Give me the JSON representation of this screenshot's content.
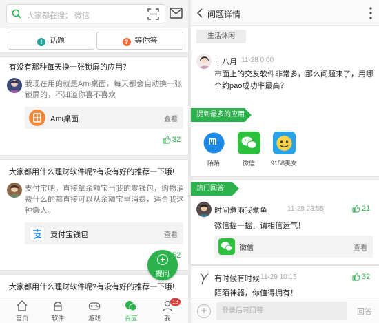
{
  "left": {
    "search": {
      "placeholder": "大家都在搜： 微信"
    },
    "segments": [
      {
        "label": "话题",
        "dot": "!",
        "color": "#26a69a"
      },
      {
        "label": "等你答",
        "dot": "?",
        "color": "#ef6c3a"
      }
    ],
    "posts": [
      {
        "question": "有没有那种每天换一张锁屏的应用？",
        "answer": "我现在用的就是Ami桌面，每天都会自动换一张锁屏的，不知道你喜不喜欢",
        "app_name": "Ami桌面",
        "app_color": "#f0893a",
        "view_label": "查看",
        "likes": "32"
      },
      {
        "question": "大家都用什么理财软件呢?有没有好的推荐一下哦!",
        "answer": "支付宝吧，直接拿余额宝当我的零钱包，购物消费什么的都直接可以从余额宝里消费，适合我这种懒人。",
        "app_name": "支付宝钱包",
        "app_color": "#1e88e5",
        "view_label": "查看",
        "likes": "52"
      },
      {
        "question": "大家都用什么理财软件呢?有没有好的推荐一下哦!"
      }
    ],
    "fab_label": "提问",
    "tabs": [
      {
        "label": "首页"
      },
      {
        "label": "软件"
      },
      {
        "label": "游戏"
      },
      {
        "label": "百应"
      },
      {
        "label": "我",
        "badge": "13"
      }
    ]
  },
  "right": {
    "title": "问题详情",
    "tag": "生活休闲",
    "asker": {
      "name": "十八月",
      "time": "11-28 0:00"
    },
    "question": "市面上的交友软件非常多，那么问题来了，用哪个约pao成功率最高？",
    "most_mentioned_label": "提到最多的应用",
    "apps": [
      {
        "name": "陌陌",
        "color": "#1e88e5"
      },
      {
        "name": "微信",
        "color": "#2bc13d"
      },
      {
        "name": "9158美女",
        "color": "#29a3e8"
      }
    ],
    "hot_label": "热门回答",
    "answers": [
      {
        "user": "时间煮雨我煮鱼",
        "time": "11-28 23:55",
        "likes": "21",
        "text": "微信摇一摇，请相信运气！",
        "app_name": "微信",
        "view_label": "查看"
      },
      {
        "user": "有时候有时候",
        "time": "11-29 10:15",
        "likes": "32",
        "text": "陌陌神器，你值得拥有！"
      }
    ],
    "input_placeholder": "登录后可回答",
    "reply_label": "回答"
  },
  "colors": {
    "accent": "#2bb24c"
  }
}
